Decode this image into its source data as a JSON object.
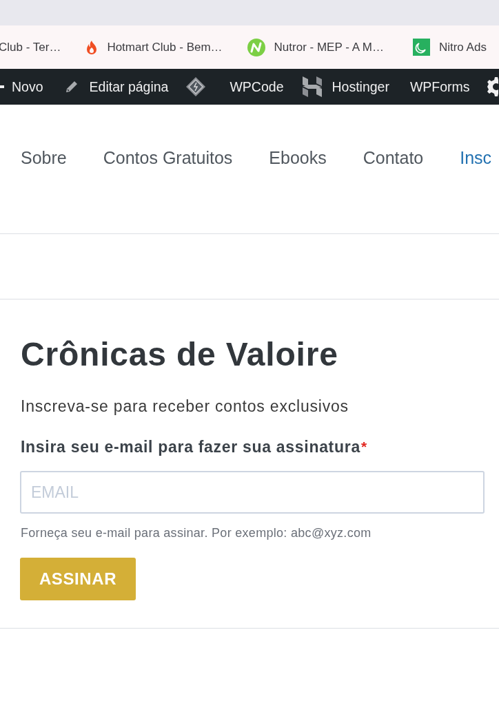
{
  "bookmarks_bar": {
    "items": [
      {
        "title": "Club - Ter…"
      },
      {
        "title": "Hotmart Club - Bem…"
      },
      {
        "title": "Nutror - MEP - A M…"
      },
      {
        "title": "Nitro Ads"
      }
    ]
  },
  "admin_bar": {
    "items": [
      {
        "label": "Novo"
      },
      {
        "label": "Editar página"
      },
      {
        "label": "WPCode"
      },
      {
        "label": "Hostinger"
      },
      {
        "label": "WPForms"
      }
    ]
  },
  "site_nav": {
    "items": [
      {
        "label": "Sobre",
        "selected": false
      },
      {
        "label": "Contos Gratuitos",
        "selected": false
      },
      {
        "label": "Ebooks",
        "selected": false
      },
      {
        "label": "Contato",
        "selected": false
      },
      {
        "label": "Insc",
        "selected": true
      }
    ]
  },
  "subscribe_form": {
    "title": "Crônicas de Valoire",
    "subtitle": "Inscreva-se para receber contos exclusivos",
    "field_label": "Insira seu e-mail para fazer sua assinatura",
    "required_mark": "*",
    "email_field": {
      "placeholder": "EMAIL"
    },
    "help_text": "Forneça seu e-mail para assinar. Por exemplo: abc@xyz.com",
    "submit_button": "ASSINAR"
  }
}
